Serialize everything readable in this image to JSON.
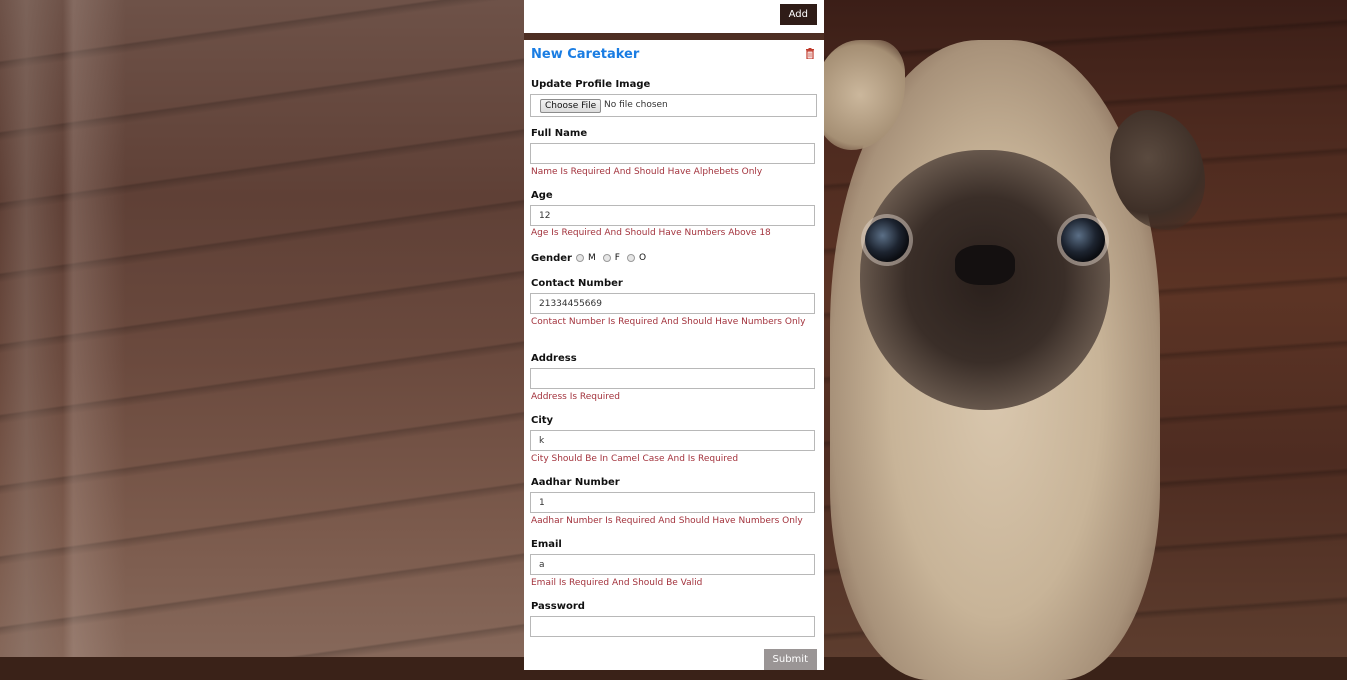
{
  "top_panel": {
    "add_label": "Add"
  },
  "form": {
    "title": "New Caretaker",
    "profile_image": {
      "label": "Update Profile Image",
      "button": "Choose File",
      "status": "No file chosen"
    },
    "full_name": {
      "label": "Full Name",
      "value": "",
      "error": "Name Is Required And Should Have Alphebets Only"
    },
    "age": {
      "label": "Age",
      "value": "12",
      "error": "Age Is Required And Should Have Numbers Above 18"
    },
    "gender": {
      "label": "Gender",
      "options": [
        "M",
        "F",
        "O"
      ]
    },
    "contact": {
      "label": "Contact Number",
      "value": "21334455669",
      "error": "Contact Number Is Required And Should Have Numbers Only"
    },
    "address": {
      "label": "Address",
      "value": "",
      "error": "Address Is Required"
    },
    "city": {
      "label": "City",
      "value": "k",
      "error": "City Should Be In Camel Case And Is Required"
    },
    "aadhar": {
      "label": "Aadhar Number",
      "value": "1",
      "error": "Aadhar Number Is Required And Should Have Numbers Only"
    },
    "email": {
      "label": "Email",
      "value": "a",
      "error": "Email Is Required And Should Be Valid"
    },
    "password": {
      "label": "Password",
      "value": ""
    },
    "submit_label": "Submit"
  },
  "colors": {
    "title_blue": "#1a7de3",
    "error_red": "#a3333d",
    "add_button_bg": "#2f1c17",
    "trash_red": "#c0392b"
  }
}
